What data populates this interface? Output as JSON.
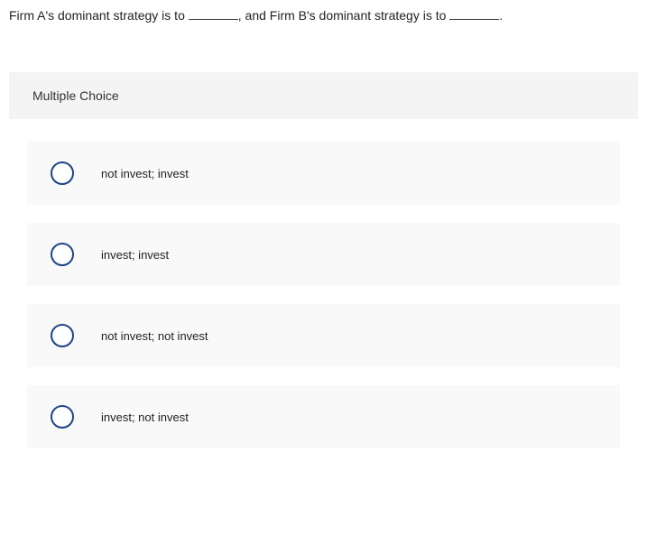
{
  "question": {
    "prefix": "Firm A's dominant strategy is to ",
    "middle": ", and Firm B's dominant strategy is to ",
    "suffix": "."
  },
  "header": "Multiple Choice",
  "options": [
    {
      "label": "not invest; invest"
    },
    {
      "label": "invest; invest"
    },
    {
      "label": "not invest; not invest"
    },
    {
      "label": "invest; not invest"
    }
  ]
}
